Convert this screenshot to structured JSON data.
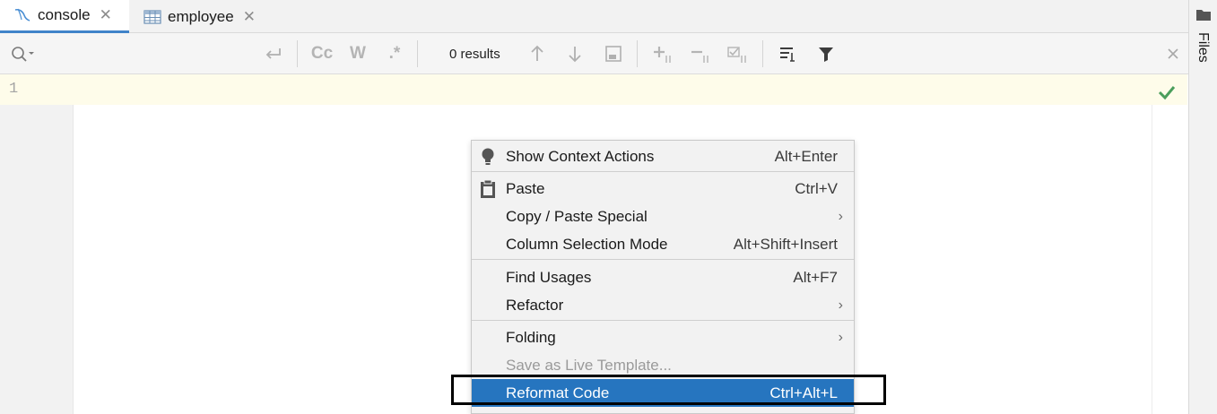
{
  "tabs": [
    {
      "label": "console",
      "icon": "mysql-console-icon",
      "active": true
    },
    {
      "label": "employee",
      "icon": "table-icon",
      "active": false
    }
  ],
  "search": {
    "value": "",
    "results_label": "0 results",
    "match_case_label": "Cc",
    "words_label": "W",
    "regex_label": ".*"
  },
  "editor": {
    "line_number": "1",
    "status_color": "#4a9e5c"
  },
  "sidebar": {
    "files_label": "Files"
  },
  "context_menu": {
    "items": [
      {
        "label": "Show Context Actions",
        "shortcut": "Alt+Enter",
        "icon": "lightbulb-icon"
      },
      {
        "label": "Paste",
        "shortcut": "Ctrl+V",
        "icon": "clipboard-icon"
      },
      {
        "label": "Copy / Paste Special",
        "shortcut": "",
        "submenu": true
      },
      {
        "label": "Column Selection Mode",
        "shortcut": "Alt+Shift+Insert"
      },
      {
        "label": "Find Usages",
        "shortcut": "Alt+F7"
      },
      {
        "label": "Refactor",
        "shortcut": "",
        "submenu": true
      },
      {
        "label": "Folding",
        "shortcut": "",
        "submenu": true
      },
      {
        "label": "Save as Live Template...",
        "shortcut": "",
        "disabled": true
      },
      {
        "label": "Reformat Code",
        "shortcut": "Ctrl+Alt+L",
        "selected": true
      }
    ],
    "selected_color": "#2675bf"
  }
}
